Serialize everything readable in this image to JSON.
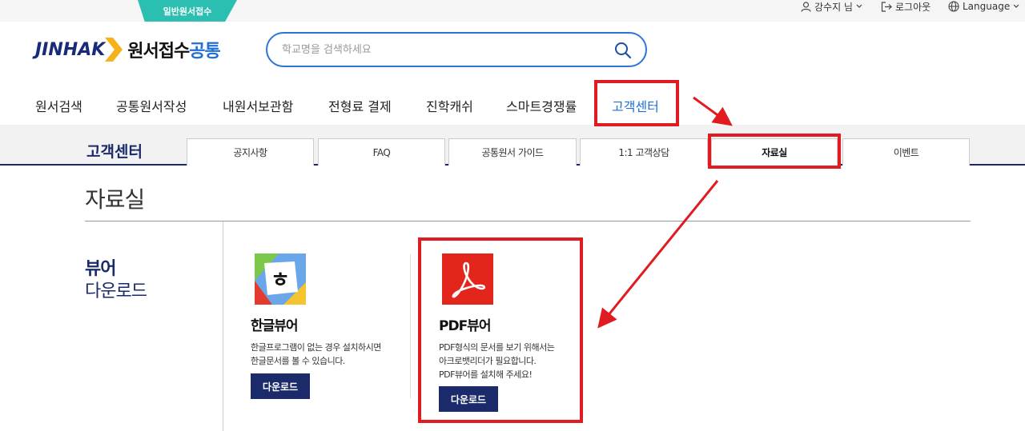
{
  "topbar": {
    "tab_label": "일반원서접수",
    "user_label": "강수지 님",
    "logout_label": "로그아웃",
    "language_label": "Language"
  },
  "header": {
    "logo_brand": "JINHAK",
    "logo_title_main": "원서접수",
    "logo_title_accent": "공통",
    "search_placeholder": "학교명을 검색하세요"
  },
  "gnb": {
    "items": [
      "원서검색",
      "공통원서작성",
      "내원서보관함",
      "전형료 결제",
      "진학캐쉬",
      "스마트경쟁률",
      "고객센터"
    ]
  },
  "subnav": {
    "title": "고객센터",
    "tabs": [
      "공지사항",
      "FAQ",
      "공통원서 가이드",
      "1:1 고객상담",
      "자료실",
      "이벤트"
    ]
  },
  "page": {
    "title": "자료실",
    "section_title_bold": "뷰어",
    "section_title_normal": "다운로드"
  },
  "viewers": [
    {
      "name": "한글뷰어",
      "desc_line1": "한글프로그램이 없는 경우 설치하시면",
      "desc_line2": "한글문서를 볼 수 있습니다.",
      "button": "다운로드"
    },
    {
      "name": "PDF뷰어",
      "desc_line1": "PDF형식의 문서를 보기 위해서는",
      "desc_line2": "아크로뱃리더가 필요합니다.",
      "desc_line3": "PDF뷰어를 설치해 주세요!",
      "button": "다운로드"
    }
  ],
  "colors": {
    "teal": "#2bbfb1",
    "navy": "#1a2a6a",
    "blue": "#1f6fd6",
    "highlight_red": "#e01b22"
  }
}
